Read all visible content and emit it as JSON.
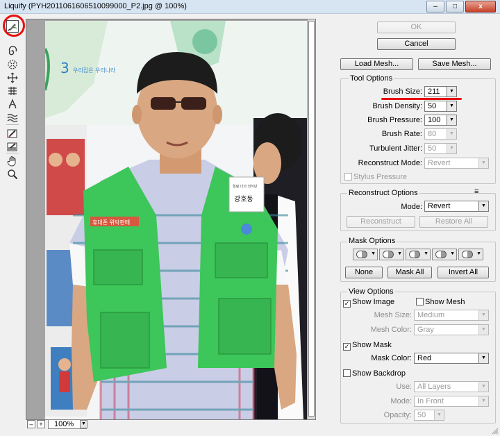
{
  "window": {
    "title": "Liquify (PYH2011061606510099000_P2.jpg @ 100%)",
    "min_label": "–",
    "max_label": "□",
    "close_label": "x"
  },
  "tools": [
    {
      "name": "forward-warp-tool-icon",
      "active": true
    },
    {
      "name": "twirl-clockwise-tool-icon"
    },
    {
      "name": "pucker-tool-icon"
    },
    {
      "name": "bloat-tool-icon"
    },
    {
      "name": "push-left-tool-icon"
    },
    {
      "name": "mirror-tool-icon"
    },
    {
      "name": "turbulence-tool-icon"
    },
    {
      "name": "freeze-mask-tool-icon"
    },
    {
      "name": "thaw-mask-tool-icon"
    },
    {
      "name": "hand-tool-icon"
    },
    {
      "name": "zoom-tool-icon"
    }
  ],
  "canvas": {
    "zoom_value": "100%",
    "zoom_out_label": "–",
    "zoom_in_label": "+",
    "photo_text": {
      "banner_number": "3",
      "banner_text": "우리집은 우리나라",
      "badge_line1": "힐링 나의 외식단",
      "badge_line2": "강호동",
      "vest_logo": "휴대폰 위탁판매"
    }
  },
  "buttons": {
    "ok": "OK",
    "cancel": "Cancel",
    "load_mesh": "Load Mesh...",
    "save_mesh": "Save Mesh...",
    "reconstruct": "Reconstruct",
    "restore_all": "Restore All",
    "none": "None",
    "mask_all": "Mask All",
    "invert_all": "Invert All"
  },
  "tool_options": {
    "title": "Tool Options",
    "brush_size_label": "Brush Size:",
    "brush_size": "211",
    "brush_density_label": "Brush Density:",
    "brush_density": "50",
    "brush_pressure_label": "Brush Pressure:",
    "brush_pressure": "100",
    "brush_rate_label": "Brush Rate:",
    "brush_rate": "80",
    "turbulent_jitter_label": "Turbulent Jitter:",
    "turbulent_jitter": "50",
    "reconstruct_mode_label": "Reconstruct Mode:",
    "reconstruct_mode": "Revert",
    "stylus_pressure_label": "Stylus Pressure"
  },
  "reconstruct_options": {
    "title": "Reconstruct Options",
    "menu_icon": "≡",
    "mode_label": "Mode:",
    "mode": "Revert"
  },
  "mask_options": {
    "title": "Mask Options",
    "button_count": 5
  },
  "view_options": {
    "title": "View Options",
    "show_image_label": "Show Image",
    "show_image": true,
    "show_mesh_label": "Show Mesh",
    "show_mesh": false,
    "mesh_size_label": "Mesh Size:",
    "mesh_size": "Medium",
    "mesh_color_label": "Mesh Color:",
    "mesh_color": "Gray",
    "show_mask_label": "Show Mask",
    "show_mask": true,
    "mask_color_label": "Mask Color:",
    "mask_color": "Red",
    "show_backdrop_label": "Show Backdrop",
    "show_backdrop": false,
    "use_label": "Use:",
    "use": "All Layers",
    "mode_label": "Mode:",
    "mode": "In Front",
    "opacity_label": "Opacity:",
    "opacity": "50"
  },
  "colors": {
    "highlight": "#e81010",
    "vest": "#3dc65a",
    "dialog_bg": "#f0f0f0"
  }
}
